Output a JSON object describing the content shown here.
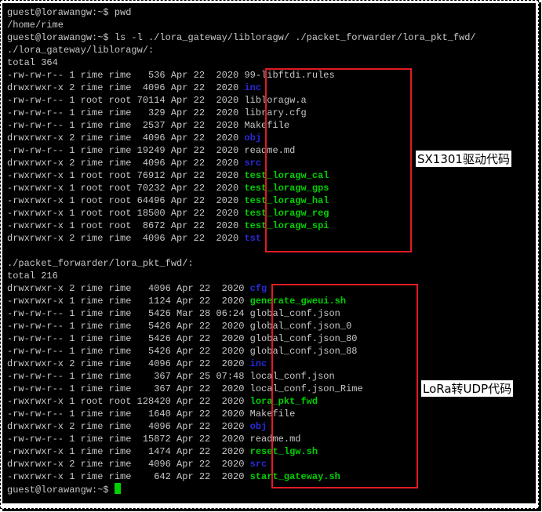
{
  "colors": {
    "background": "#000000",
    "text": "#c8c8c8",
    "dir": "#2a2ad8",
    "exec": "#00d000",
    "annotation_box": "#e01b24"
  },
  "annotations": {
    "sx1301": "SX1301驱动代码",
    "lora_udp": "LoRa转UDP代码"
  },
  "lines": [
    {
      "text": "guest@lorawangw:~$ pwd"
    },
    {
      "text": "/home/rime"
    },
    {
      "text": "guest@lorawangw:~$ ls -l ./lora_gateway/libloragw/ ./packet_forwarder/lora_pkt_fwd/"
    },
    {
      "text": "./lora_gateway/libloragw/:"
    },
    {
      "text": "total 364"
    },
    {
      "prefix": "-rw-rw-r-- 1 rime rime   536 Apr 22  2020 ",
      "name": "99-libftdi.rules",
      "kind": "white"
    },
    {
      "prefix": "drwxrwxr-x 2 rime rime  4096 Apr 22  2020 ",
      "name": "inc",
      "kind": "blue"
    },
    {
      "prefix": "-rw-rw-r-- 1 root root 70114 Apr 22  2020 ",
      "name": "libloragw.a",
      "kind": "white"
    },
    {
      "prefix": "-rw-rw-r-- 1 rime rime   329 Apr 22  2020 ",
      "name": "library.cfg",
      "kind": "white"
    },
    {
      "prefix": "-rw-rw-r-- 1 rime rime  2537 Apr 22  2020 ",
      "name": "Makefile",
      "kind": "white"
    },
    {
      "prefix": "drwxrwxr-x 2 rime rime  4096 Apr 22  2020 ",
      "name": "obj",
      "kind": "blue"
    },
    {
      "prefix": "-rw-rw-r-- 1 rime rime 19249 Apr 22  2020 ",
      "name": "readme.md",
      "kind": "white"
    },
    {
      "prefix": "drwxrwxr-x 2 rime rime  4096 Apr 22  2020 ",
      "name": "src",
      "kind": "blue"
    },
    {
      "prefix": "-rwxrwxr-x 1 root root 76912 Apr 22  2020 ",
      "name": "test_loragw_cal",
      "kind": "green"
    },
    {
      "prefix": "-rwxrwxr-x 1 root root 70232 Apr 22  2020 ",
      "name": "test_loragw_gps",
      "kind": "green"
    },
    {
      "prefix": "-rwxrwxr-x 1 root root 64496 Apr 22  2020 ",
      "name": "test_loragw_hal",
      "kind": "green"
    },
    {
      "prefix": "-rwxrwxr-x 1 root root 18500 Apr 22  2020 ",
      "name": "test_loragw_reg",
      "kind": "green"
    },
    {
      "prefix": "-rwxrwxr-x 1 root root  8672 Apr 22  2020 ",
      "name": "test_loragw_spi",
      "kind": "green"
    },
    {
      "prefix": "drwxrwxr-x 2 rime rime  4096 Apr 22  2020 ",
      "name": "tst",
      "kind": "blue"
    },
    {
      "text": ""
    },
    {
      "text": "./packet_forwarder/lora_pkt_fwd/:"
    },
    {
      "text": "total 216"
    },
    {
      "prefix": "drwxrwxr-x 2 rime rime   4096 Apr 22  2020 ",
      "name": "cfg",
      "kind": "blue"
    },
    {
      "prefix": "-rwxrwxr-x 1 rime rime   1124 Apr 22  2020 ",
      "name": "generate_gweui.sh",
      "kind": "green"
    },
    {
      "prefix": "-rw-rw-r-- 1 rime rime   5426 Mar 28 06:24 ",
      "name": "global_conf.json",
      "kind": "white"
    },
    {
      "prefix": "-rw-rw-r-- 1 rime rime   5426 Apr 22  2020 ",
      "name": "global_conf.json_0",
      "kind": "white"
    },
    {
      "prefix": "-rw-rw-r-- 1 rime rime   5426 Apr 22  2020 ",
      "name": "global_conf.json_80",
      "kind": "white"
    },
    {
      "prefix": "-rw-rw-r-- 1 rime rime   5426 Apr 22  2020 ",
      "name": "global_conf.json_88",
      "kind": "white"
    },
    {
      "prefix": "drwxrwxr-x 2 rime rime   4096 Apr 22  2020 ",
      "name": "inc",
      "kind": "blue"
    },
    {
      "prefix": "-rw-rw-r-- 1 rime rime    367 Apr 25 07:48 ",
      "name": "local_conf.json",
      "kind": "white"
    },
    {
      "prefix": "-rw-rw-r-- 1 rime rime    367 Apr 22  2020 ",
      "name": "local_conf.json_Rime",
      "kind": "white"
    },
    {
      "prefix": "-rwxrwxr-x 1 root root 128420 Apr 22  2020 ",
      "name": "lora_pkt_fwd",
      "kind": "green"
    },
    {
      "prefix": "-rw-rw-r-- 1 rime rime   1640 Apr 22  2020 ",
      "name": "Makefile",
      "kind": "white"
    },
    {
      "prefix": "drwxrwxr-x 2 rime rime   4096 Apr 22  2020 ",
      "name": "obj",
      "kind": "blue"
    },
    {
      "prefix": "-rw-rw-r-- 1 rime rime  15872 Apr 22  2020 ",
      "name": "readme.md",
      "kind": "white"
    },
    {
      "prefix": "-rwxrwxr-x 1 rime rime   1474 Apr 22  2020 ",
      "name": "reset_lgw.sh",
      "kind": "green"
    },
    {
      "prefix": "drwxrwxr-x 2 rime rime   4096 Apr 22  2020 ",
      "name": "src",
      "kind": "blue"
    },
    {
      "prefix": "-rwxrwxr-x 1 rime rime    642 Apr 22  2020 ",
      "name": "start_gateway.sh",
      "kind": "green"
    },
    {
      "text": "guest@lorawangw:~$ ",
      "cursor": true
    }
  ]
}
